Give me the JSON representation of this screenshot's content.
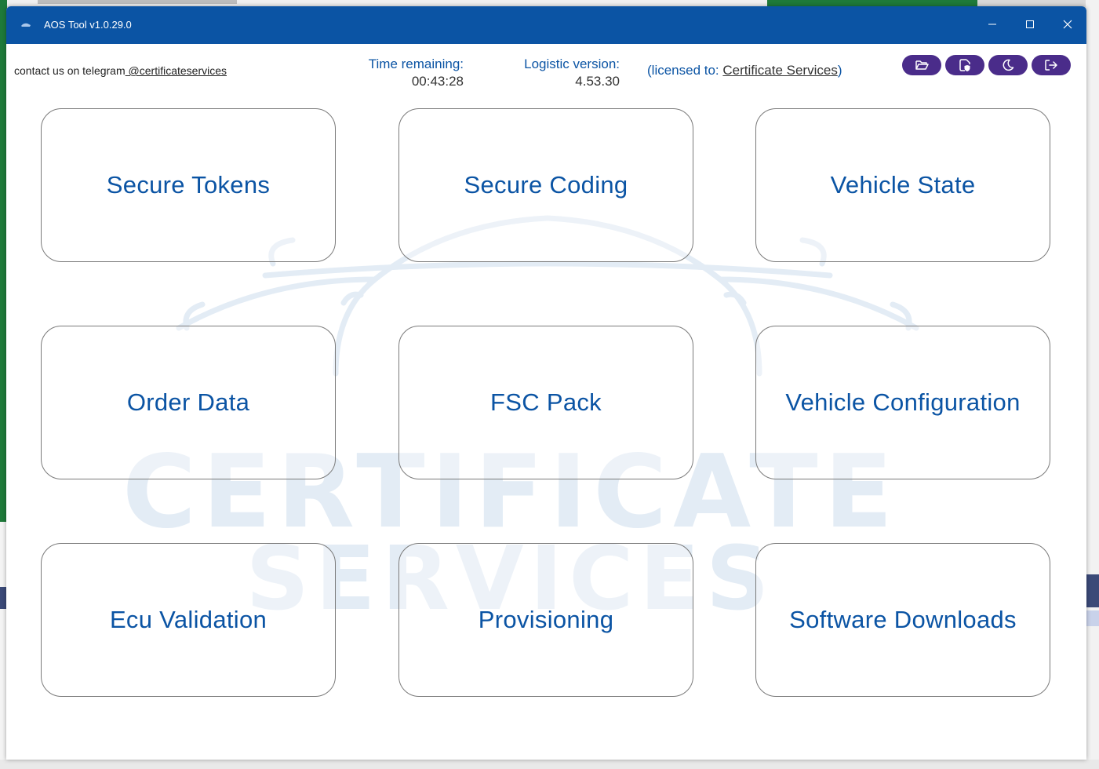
{
  "window": {
    "title": "AOS Tool v1.0.29.0"
  },
  "header": {
    "contact_prefix": "contact us on telegram",
    "contact_handle": " @certificateservices",
    "time_remaining_label": "Time remaining:",
    "time_remaining_value": "00:43:28",
    "logistic_version_label": "Logistic version:",
    "logistic_version_value": "4.53.30",
    "licensed_prefix": "(licensed to: ",
    "licensed_name": "Certificate Services",
    "licensed_suffix": ")"
  },
  "toolbar_buttons": [
    {
      "icon": "folder-open-icon"
    },
    {
      "icon": "shield-file-icon"
    },
    {
      "icon": "moon-icon"
    },
    {
      "icon": "logout-icon"
    }
  ],
  "watermark": {
    "line1": "CERTIFICATE",
    "line2": "SERVICES"
  },
  "tiles": [
    {
      "label": "Secure Tokens"
    },
    {
      "label": "Secure Coding"
    },
    {
      "label": "Vehicle State"
    },
    {
      "label": "Order Data"
    },
    {
      "label": "FSC Pack"
    },
    {
      "label": "Vehicle Configuration"
    },
    {
      "label": "Ecu Validation"
    },
    {
      "label": "Provisioning"
    },
    {
      "label": "Software Downloads"
    }
  ],
  "colors": {
    "titlebar": "#0b54a4",
    "accent_text": "#0b54a4",
    "toolbar_button": "#4a2c8a",
    "watermark": "#e3ecf5"
  }
}
